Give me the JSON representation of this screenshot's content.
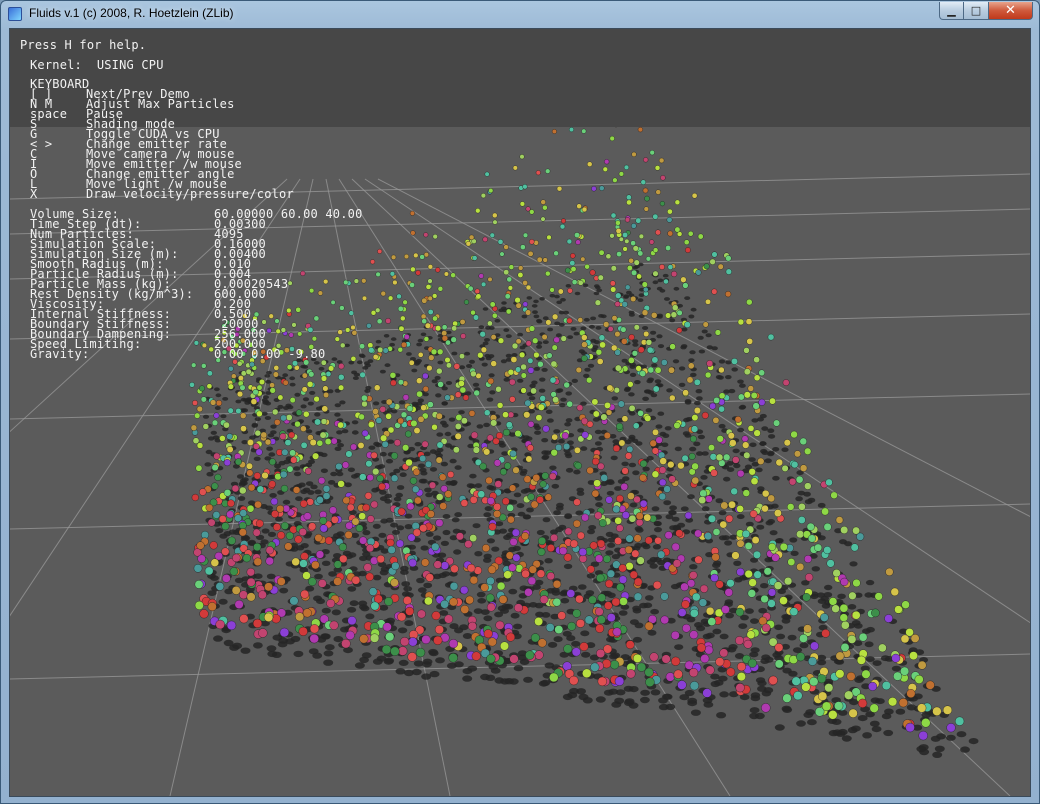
{
  "window": {
    "title": "Fluids v.1 (c) 2008, R. Hoetzlein (ZLib)",
    "controls": {
      "minimize": "▁",
      "maximize": "□",
      "close": "✕"
    }
  },
  "hud": {
    "help_hint": "Press H for help.",
    "kernel_line": "Kernel:  USING CPU",
    "keyboard_heading": "KEYBOARD",
    "keyboard": [
      {
        "key": "[ ]",
        "desc": "Next/Prev Demo"
      },
      {
        "key": "N M",
        "desc": "Adjust Max Particles"
      },
      {
        "key": "space",
        "desc": "Pause"
      },
      {
        "key": "S",
        "desc": "Shading mode"
      },
      {
        "key": "G",
        "desc": "Toggle CUDA vs CPU"
      },
      {
        "key": "< >",
        "desc": "Change emitter rate"
      },
      {
        "key": "C",
        "desc": "Move camera /w mouse"
      },
      {
        "key": "I",
        "desc": "Move emitter /w mouse"
      },
      {
        "key": "O",
        "desc": "Change emitter angle"
      },
      {
        "key": "L",
        "desc": "Move light /w mouse"
      },
      {
        "key": "X",
        "desc": "Draw velocity/pressure/color"
      }
    ],
    "parameters": [
      {
        "label": "Volume Size:",
        "value": "60.00000 60.00 40.00"
      },
      {
        "label": "Time Step (dt):",
        "value": "0.00300"
      },
      {
        "label": "Num Particles:",
        "value": "4095"
      },
      {
        "label": "Simulation Scale:",
        "value": "0.16000"
      },
      {
        "label": "Simulation Size (m):",
        "value": "0.00400"
      },
      {
        "label": "Smooth Radius (m):",
        "value": "0.010"
      },
      {
        "label": "Particle Radius (m):",
        "value": "0.004"
      },
      {
        "label": "Particle Mass (kg):",
        "value": "0.00020543"
      },
      {
        "label": "Rest Density (kg/m^3):",
        "value": "600.000"
      },
      {
        "label": "Viscosity:",
        "value": "0.200"
      },
      {
        "label": "Internal Stiffness:",
        "value": "0.500"
      },
      {
        "label": "Boundary Stiffness:",
        "value": " 20000"
      },
      {
        "label": "Boundary Dampening:",
        "value": "256.000"
      },
      {
        "label": "Speed Limiting:",
        "value": "200.000"
      },
      {
        "label": "Gravity:",
        "value": "0.00 0.00 -9.80"
      }
    ]
  },
  "scene": {
    "background_color": "#5b5b5b",
    "grid_color": "#9a9a9a",
    "shadow_color": "#262626",
    "particle_palette_front": [
      "#d23a3a",
      "#c24470",
      "#b03ab0",
      "#8b3fd6",
      "#e05050",
      "#3c8f4a",
      "#4a9a9a",
      "#c07030"
    ],
    "particle_palette_back": [
      "#8ed846",
      "#b8e040",
      "#d6c44a",
      "#6ad07a",
      "#c09a40",
      "#50c0a0",
      "#a0d060"
    ]
  }
}
